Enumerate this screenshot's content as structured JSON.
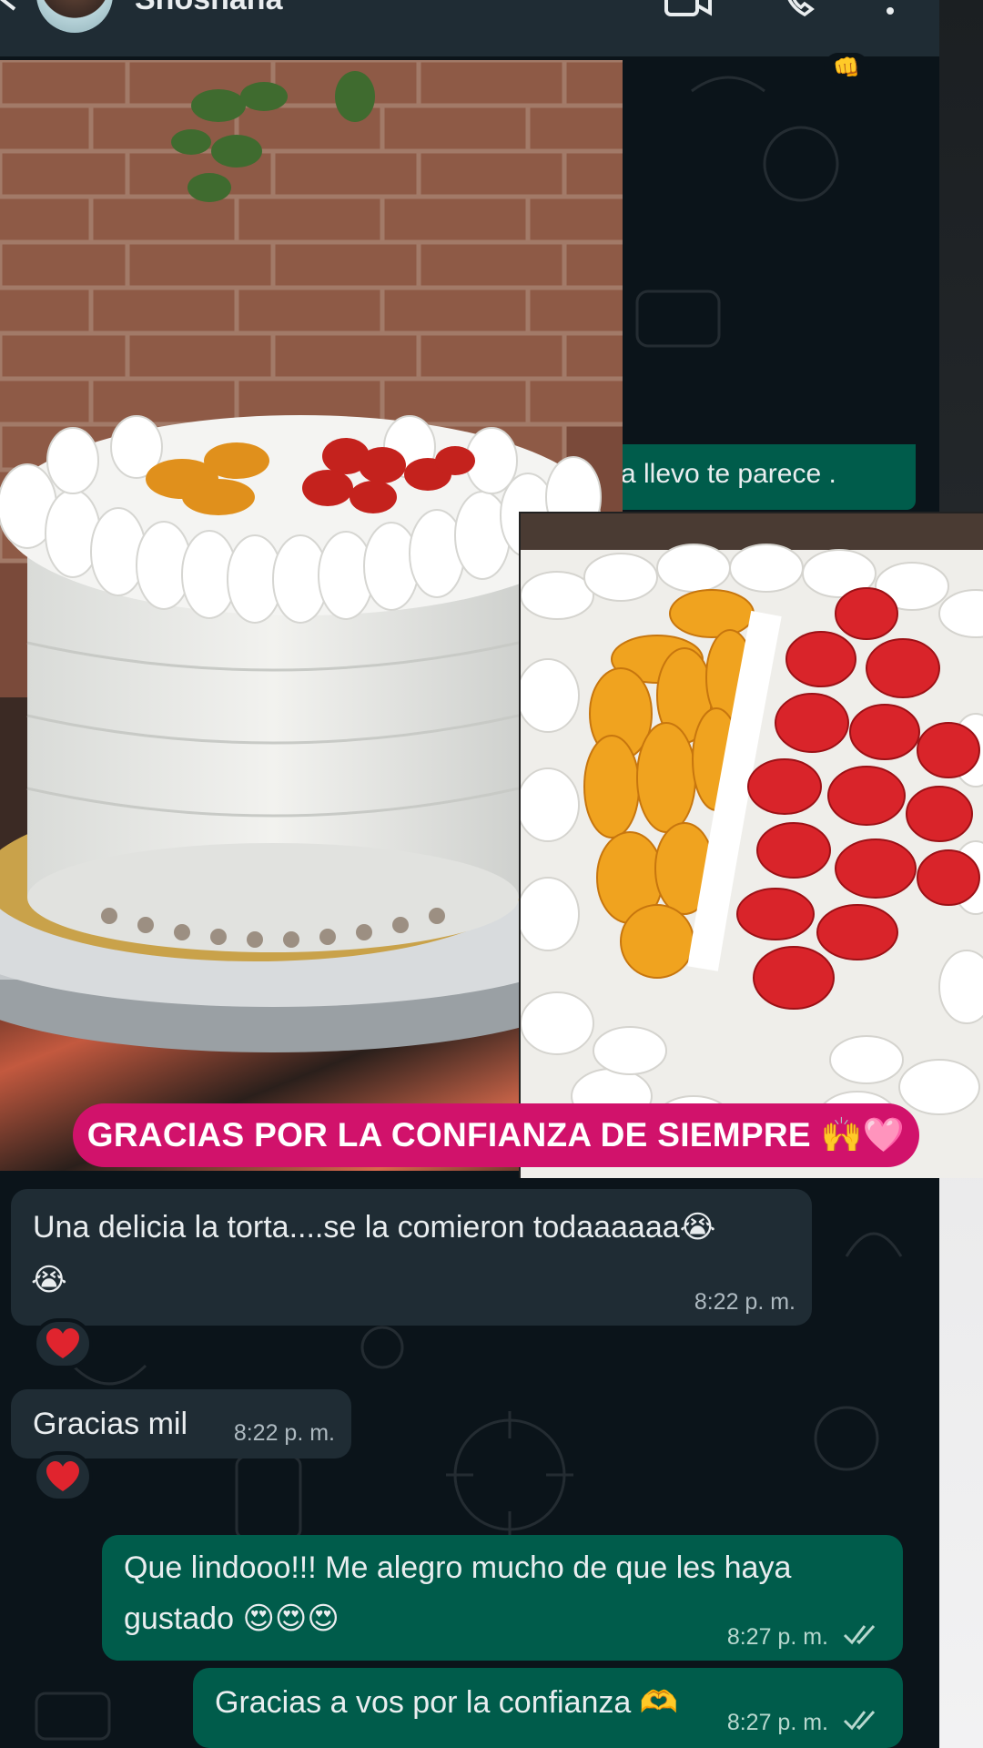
{
  "header": {
    "contact_name": "Shoshana",
    "back_icon": "back-arrow-icon",
    "video_icon": "video-call-icon",
    "call_icon": "phone-call-icon",
    "menu_icon": "more-vert-icon"
  },
  "background_messages": {
    "outgoing_partial": "a llevo te parece .",
    "reaction_emoji": "👊"
  },
  "media": {
    "caption": "GRACIAS POR LA CONFIANZA DE SIEMPRE 🙌🩷"
  },
  "messages": [
    {
      "direction": "incoming",
      "line1": "Una delicia la torta....se la comieron todaaaaaa😭",
      "line2": "😭",
      "time": "8:22 p. m.",
      "reaction": "❤️"
    },
    {
      "direction": "incoming",
      "line1": "Gracias mil",
      "time": "8:22 p. m.",
      "reaction": "❤️"
    },
    {
      "direction": "outgoing",
      "line1": "Que lindooo!!! Me alegro mucho de que les haya",
      "line2": "gustado 😍😍😍",
      "time": "8:27 p. m.",
      "status": "read"
    },
    {
      "direction": "outgoing",
      "line1": "Gracias a vos por la confianza 🫶",
      "time": "8:27 p. m.",
      "status": "read"
    }
  ],
  "colors": {
    "chat_background": "#0b141a",
    "incoming_bubble": "#1f2c34",
    "outgoing_bubble": "#005c4b",
    "caption_background": "#d1126b",
    "read_ticks": "#b8d8cf"
  }
}
